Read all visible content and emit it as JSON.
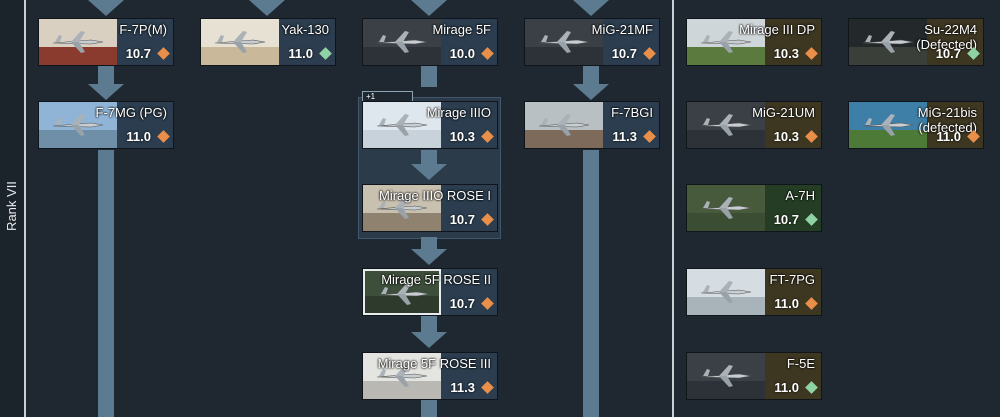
{
  "rank_label": "Rank VII",
  "badge": "+1",
  "colors": {
    "diamond_orange": "#e98f4a",
    "diamond_green": "#8fd3a4",
    "rail": "#5c7a90"
  },
  "cards": [
    {
      "id": "f7pm",
      "name": "F-7P(M)",
      "br": "10.7",
      "icon": "orange",
      "style": "normal",
      "thumb": "flag"
    },
    {
      "id": "yak130",
      "name": "Yak-130",
      "br": "11.0",
      "icon": "green",
      "style": "normal",
      "thumb": "desert"
    },
    {
      "id": "mirage5f",
      "name": "Mirage 5F",
      "br": "10.0",
      "icon": "orange",
      "style": "normal",
      "thumb": "gray"
    },
    {
      "id": "mig21mf",
      "name": "MiG-21MF",
      "br": "10.7",
      "icon": "orange",
      "style": "normal",
      "thumb": "gray"
    },
    {
      "id": "mirage3dp",
      "name": "Mirage III DP",
      "br": "10.3",
      "icon": "orange",
      "style": "premium",
      "thumb": "field"
    },
    {
      "id": "su22m4",
      "name": "Su-22M4\n(Defected)",
      "br": "10.7",
      "icon": "green",
      "style": "premium",
      "thumb": "dark"
    },
    {
      "id": "f7mg",
      "name": "F-7MG (PG)",
      "br": "11.0",
      "icon": "orange",
      "style": "normal",
      "thumb": "sky"
    },
    {
      "id": "mirage3o",
      "name": "Mirage IIIO",
      "br": "10.3",
      "icon": "orange",
      "style": "normal",
      "thumb": "snow"
    },
    {
      "id": "f7bgi",
      "name": "F-7BGI",
      "br": "11.3",
      "icon": "orange",
      "style": "normal",
      "thumb": "runway"
    },
    {
      "id": "mig21um",
      "name": "MiG-21UM",
      "br": "10.3",
      "icon": "orange",
      "style": "premium",
      "thumb": "gray"
    },
    {
      "id": "mig21bis",
      "name": "MiG-21bis\n(defected)",
      "br": "11.0",
      "icon": "orange",
      "style": "premium",
      "thumb": "palm"
    },
    {
      "id": "mirage3orose1",
      "name": "Mirage IIIO ROSE I",
      "br": "10.7",
      "icon": "orange",
      "style": "normal",
      "thumb": "runway2"
    },
    {
      "id": "a7h",
      "name": "A-7H",
      "br": "10.7",
      "icon": "green",
      "style": "squadron",
      "thumb": "camo"
    },
    {
      "id": "mirage5frose2",
      "name": "Mirage 5F ROSE II",
      "br": "10.7",
      "icon": "orange",
      "style": "normal",
      "thumb": "framed"
    },
    {
      "id": "ft7pg",
      "name": "FT-7PG",
      "br": "11.0",
      "icon": "orange",
      "style": "premium",
      "thumb": "silver"
    },
    {
      "id": "mirage5frose3",
      "name": "Mirage 5F ROSE III",
      "br": "11.3",
      "icon": "orange",
      "style": "normal",
      "thumb": "model"
    },
    {
      "id": "f5e",
      "name": "F-5E",
      "br": "11.0",
      "icon": "green",
      "style": "premium",
      "thumb": "gray"
    }
  ]
}
